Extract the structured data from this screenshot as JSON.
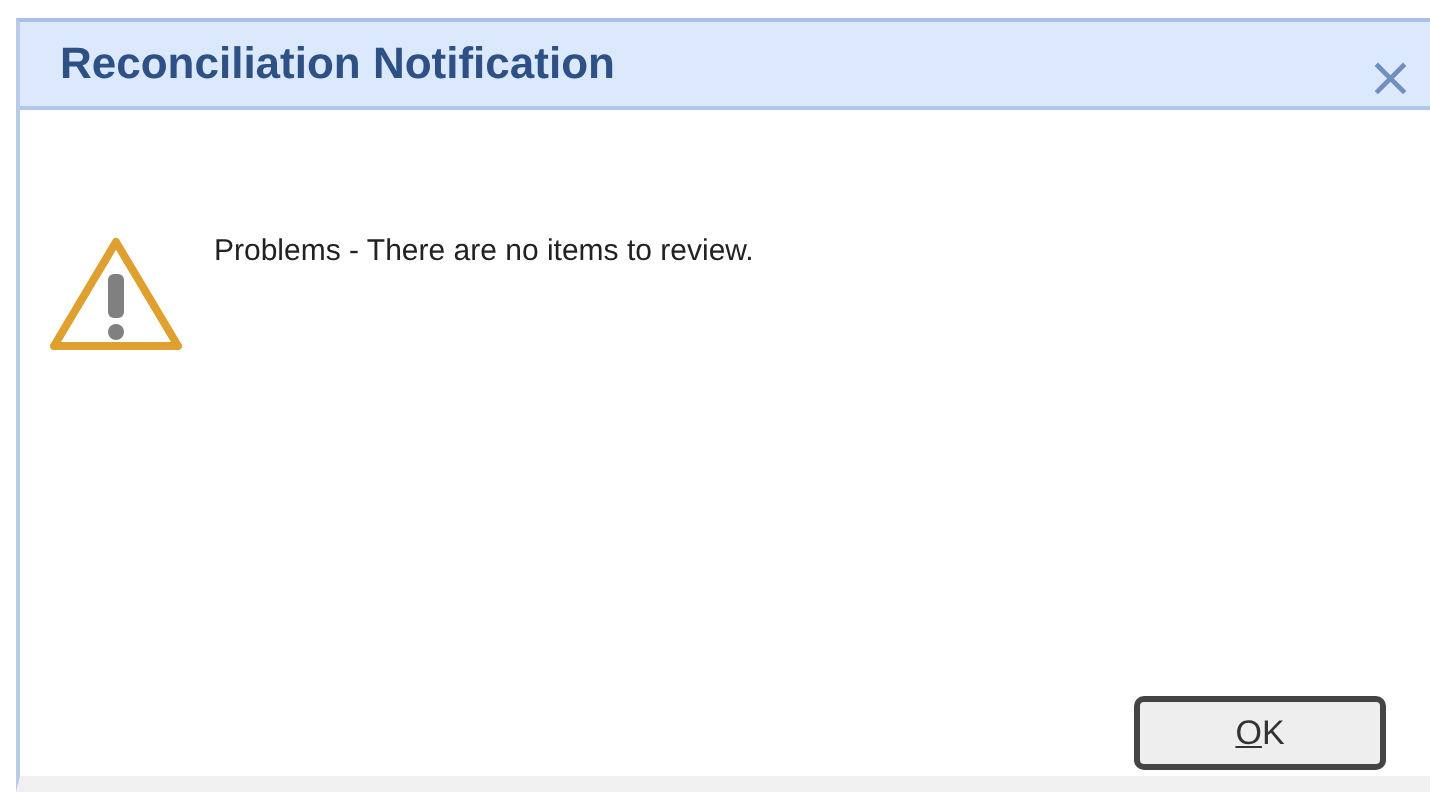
{
  "window": {
    "title": "Reconciliation Notification",
    "close": "×"
  },
  "message": {
    "kind": "warning",
    "text": "Problems - There are no items to review."
  },
  "buttons": [
    {
      "label": "OK",
      "access_key_underlined": true
    }
  ]
}
